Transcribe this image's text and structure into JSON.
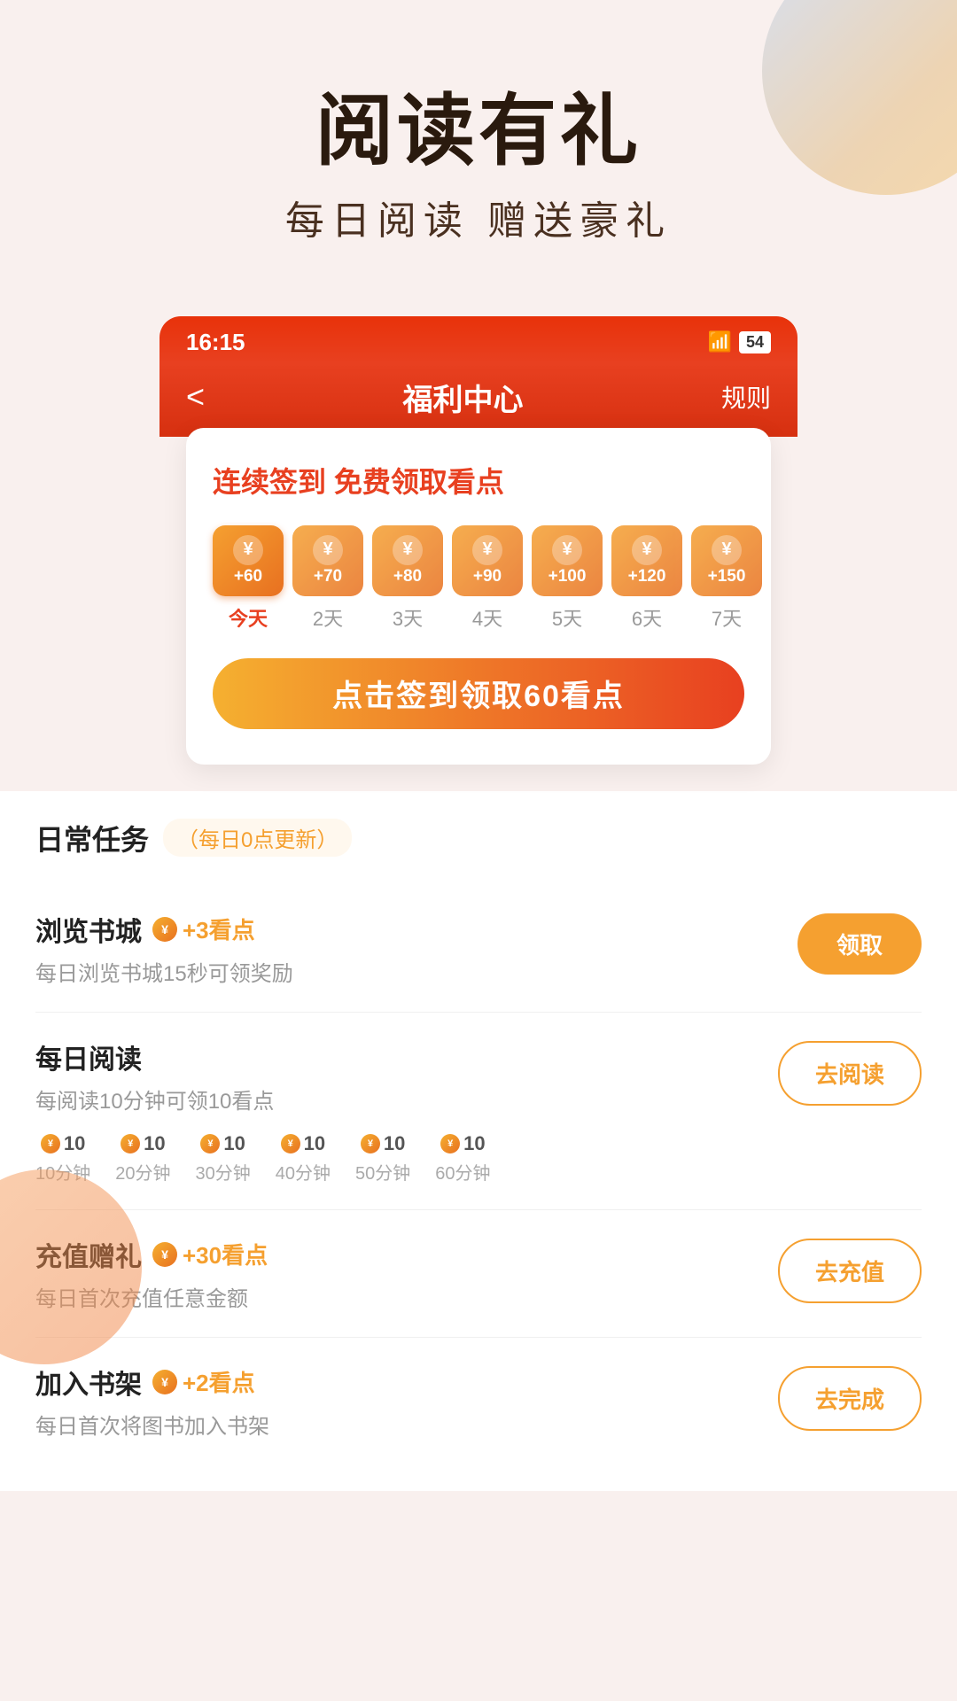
{
  "hero": {
    "title": "阅读有礼",
    "subtitle": "每日阅读  赠送豪礼"
  },
  "statusBar": {
    "time": "16:15",
    "battery": "54",
    "wifi": "wifi"
  },
  "navBar": {
    "back": "<",
    "title": "福利中心",
    "rule": "规则"
  },
  "checkin": {
    "title": "连续签到 免费领取看点",
    "days": [
      {
        "amount": "+60",
        "label": "今天",
        "isToday": true
      },
      {
        "amount": "+70",
        "label": "2天",
        "isToday": false
      },
      {
        "amount": "+80",
        "label": "3天",
        "isToday": false
      },
      {
        "amount": "+90",
        "label": "4天",
        "isToday": false
      },
      {
        "amount": "+100",
        "label": "5天",
        "isToday": false
      },
      {
        "amount": "+120",
        "label": "6天",
        "isToday": false
      },
      {
        "amount": "+150",
        "label": "7天",
        "isToday": false
      }
    ],
    "btnLabel": "点击签到领取60看点"
  },
  "tasks": {
    "title": "日常任务",
    "updateNote": "（每日0点更新）",
    "items": [
      {
        "name": "浏览书城",
        "rewardText": "+3看点",
        "desc": "每日浏览书城15秒可领奖励",
        "btnLabel": "领取",
        "btnType": "orange"
      },
      {
        "name": "每日阅读",
        "rewardText": "",
        "desc": "每阅读10分钟可领10看点",
        "btnLabel": "去阅读",
        "btnType": "outline",
        "progress": [
          {
            "amount": "10",
            "time": "10分钟"
          },
          {
            "amount": "10",
            "time": "20分钟"
          },
          {
            "amount": "10",
            "time": "30分钟"
          },
          {
            "amount": "10",
            "time": "40分钟"
          },
          {
            "amount": "10",
            "time": "50分钟"
          },
          {
            "amount": "10",
            "time": "60分钟"
          }
        ]
      },
      {
        "name": "充值赠礼",
        "rewardText": "+30看点",
        "desc": "每日首次充值任意金额",
        "btnLabel": "去充值",
        "btnType": "outline"
      },
      {
        "name": "加入书架",
        "rewardText": "+2看点",
        "desc": "每日首次将图书加入书架",
        "btnLabel": "去完成",
        "btnType": "outline"
      }
    ]
  }
}
